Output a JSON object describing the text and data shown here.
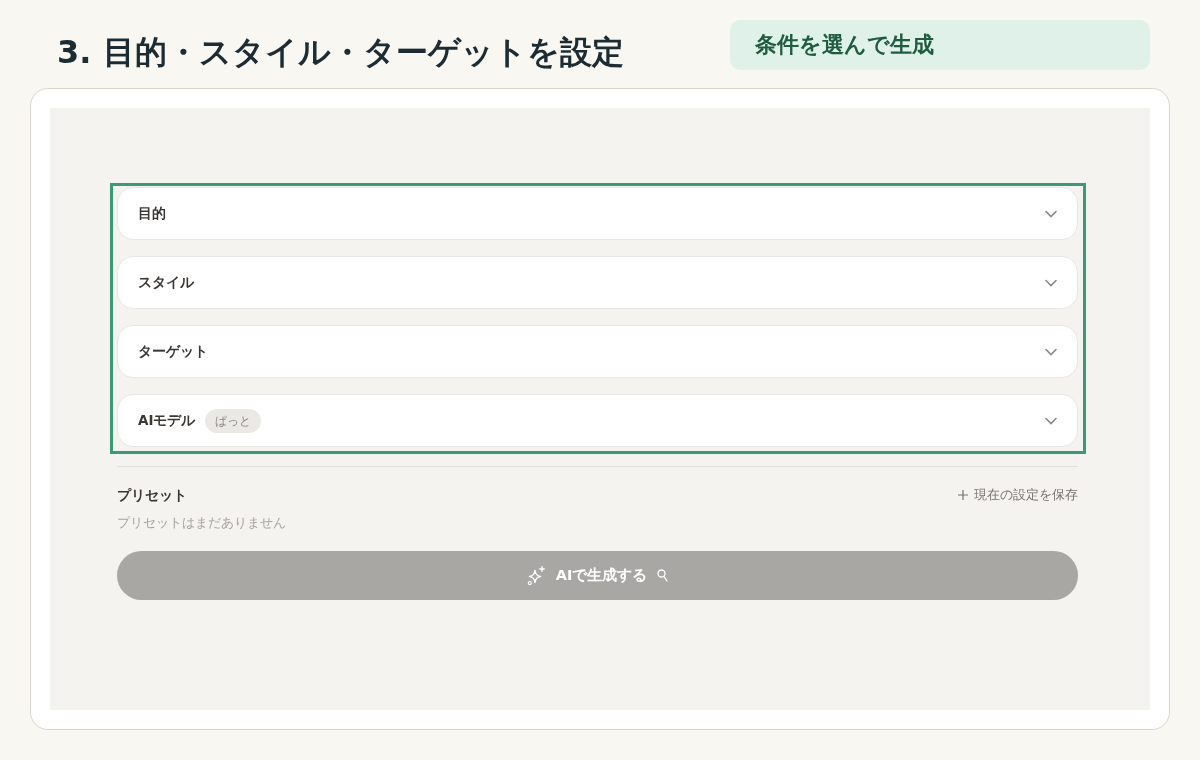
{
  "title": "3. 目的・スタイル・ターゲットを設定",
  "callout": {
    "text": "条件を選んで生成"
  },
  "settings": {
    "highlighted": true,
    "items": [
      {
        "label": "目的",
        "expanded": false
      },
      {
        "label": "スタイル",
        "expanded": false
      },
      {
        "label": "ターゲット",
        "expanded": false
      },
      {
        "label": "AIモデル",
        "tag": "ぱっと",
        "expanded": false
      }
    ]
  },
  "presets": {
    "heading": "プリセット",
    "save_link": "現在の設定を保存",
    "empty_text": "プリセットはまだありません"
  },
  "generate_button": {
    "label": "AIで生成する",
    "disabled": true
  }
}
